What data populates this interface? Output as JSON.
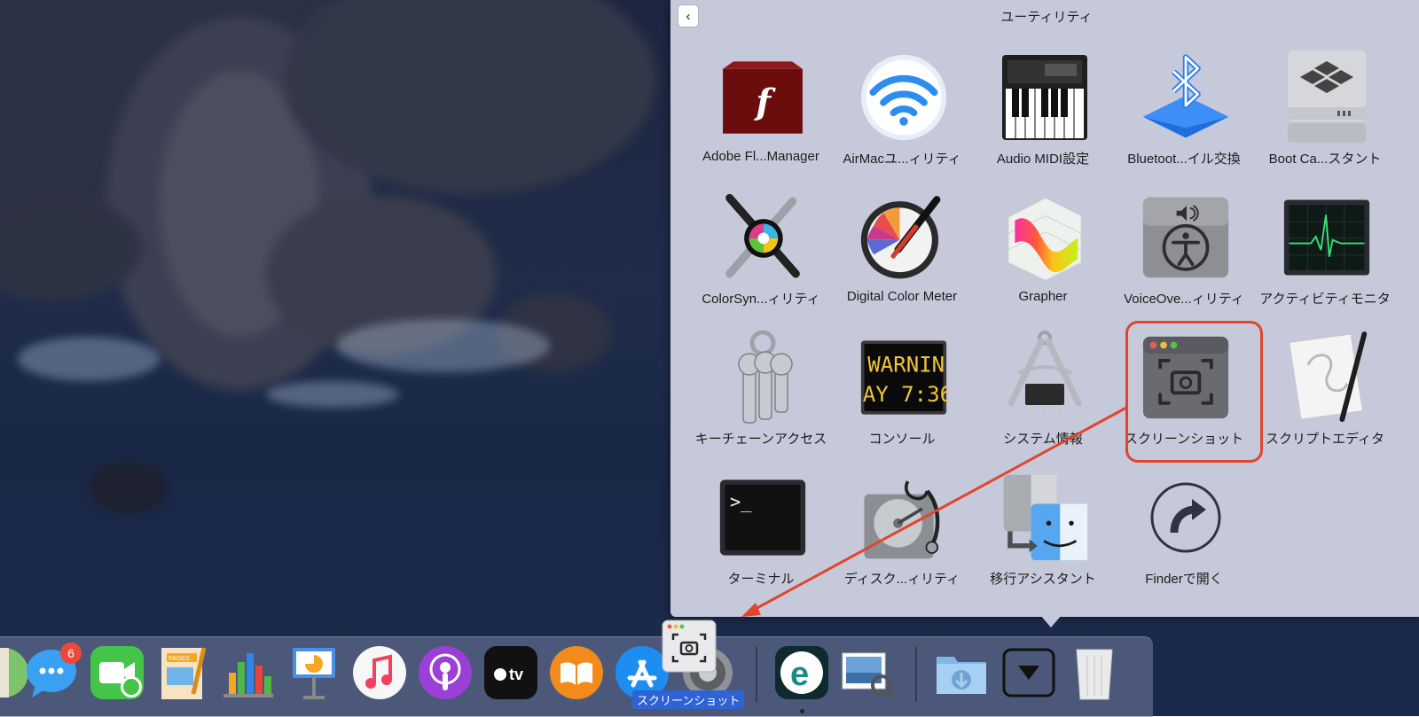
{
  "stack": {
    "title": "ユーティリティ",
    "back_label": "<",
    "apps": [
      {
        "label": "Adobe Fl...Manager",
        "icon": "flash-icon"
      },
      {
        "label": "AirMacユ...ィリティ",
        "icon": "wifi-icon"
      },
      {
        "label": "Audio MIDI設定",
        "icon": "piano-icon"
      },
      {
        "label": "Bluetoot...イル交換",
        "icon": "bluetooth-icon"
      },
      {
        "label": "Boot Ca...スタント",
        "icon": "bootcamp-icon"
      },
      {
        "label": "ColorSyn...ィリティ",
        "icon": "colorsync-icon"
      },
      {
        "label": "Digital Color Meter",
        "icon": "color-meter-icon"
      },
      {
        "label": "Grapher",
        "icon": "grapher-icon"
      },
      {
        "label": "VoiceOve...ィリティ",
        "icon": "accessibility-icon"
      },
      {
        "label": "アクティビティモニタ",
        "icon": "activity-monitor-icon"
      },
      {
        "label": "キーチェーンアクセス",
        "icon": "keys-icon"
      },
      {
        "label": "コンソール",
        "icon": "console-icon"
      },
      {
        "label": "システム情報",
        "icon": "system-info-icon"
      },
      {
        "label": "スクリーンショット",
        "icon": "screenshot-icon"
      },
      {
        "label": "スクリプトエディタ",
        "icon": "script-editor-icon"
      },
      {
        "label": "ターミナル",
        "icon": "terminal-icon"
      },
      {
        "label": "ディスク...ィリティ",
        "icon": "disk-utility-icon"
      },
      {
        "label": "移行アシスタント",
        "icon": "migration-icon"
      },
      {
        "label": "Finderで開く",
        "icon": "open-in-finder-icon"
      }
    ],
    "console_text": [
      "WARNIN",
      "AY 7:36"
    ],
    "terminal_prompt": ">_"
  },
  "dock": {
    "messages_badge": "6",
    "drag_label": "スクリーンショット",
    "apps_text": {
      "tv": "tv",
      "eset": "e",
      "pages": "PAGES"
    }
  },
  "colors": {
    "highlight": "#e0452e",
    "arrow": "#e0452e",
    "drag_label_bg": "#2f63d3"
  }
}
